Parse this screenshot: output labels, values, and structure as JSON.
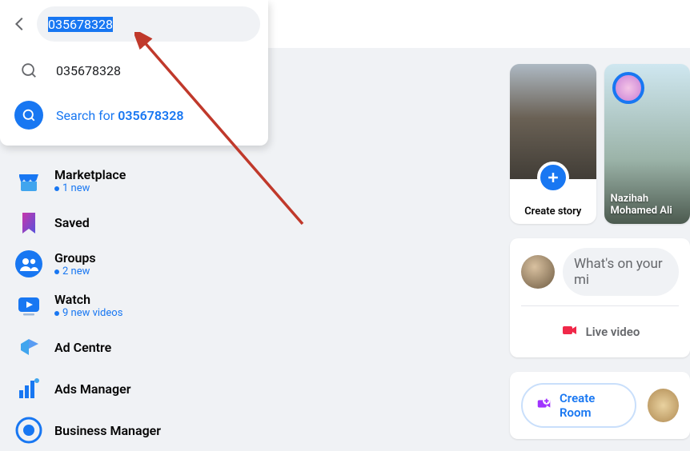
{
  "search": {
    "value": "035678328",
    "suggestion_plain": "035678328",
    "searchfor_prefix": "Search for ",
    "searchfor_term": "035678328"
  },
  "sidebar": {
    "items": [
      {
        "label": "Marketplace",
        "sub": "1 new"
      },
      {
        "label": "Saved",
        "sub": ""
      },
      {
        "label": "Groups",
        "sub": "2 new"
      },
      {
        "label": "Watch",
        "sub": "9 new videos"
      },
      {
        "label": "Ad Centre",
        "sub": ""
      },
      {
        "label": "Ads Manager",
        "sub": ""
      },
      {
        "label": "Business Manager",
        "sub": ""
      }
    ]
  },
  "stories": {
    "create_label": "Create story",
    "friend_name": "Nazihah Mohamed Ali"
  },
  "composer": {
    "placeholder": "What's on your mi",
    "live_label": "Live video"
  },
  "rooms": {
    "create_label": "Create Room"
  },
  "colors": {
    "accent": "#1877f2"
  }
}
